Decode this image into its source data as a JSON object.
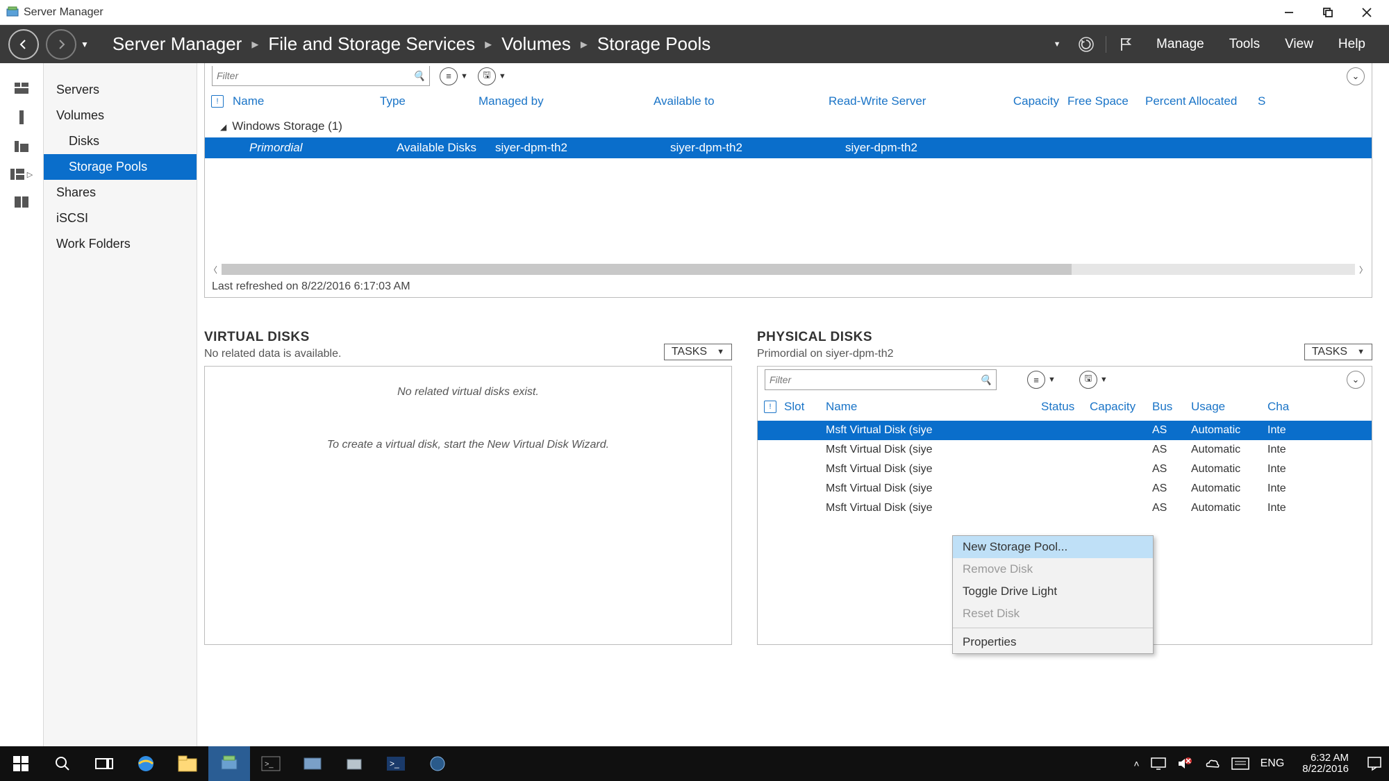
{
  "title": "Server Manager",
  "breadcrumbs": [
    "Server Manager",
    "File and Storage Services",
    "Volumes",
    "Storage Pools"
  ],
  "menus": {
    "manage": "Manage",
    "tools": "Tools",
    "view": "View",
    "help": "Help"
  },
  "sidebar": {
    "items": [
      "Servers",
      "Volumes",
      "Disks",
      "Storage Pools",
      "Shares",
      "iSCSI",
      "Work Folders"
    ]
  },
  "filter": {
    "placeholder": "Filter"
  },
  "storage_pools": {
    "headers": {
      "name": "Name",
      "type": "Type",
      "managed_by": "Managed by",
      "available_to": "Available to",
      "rws": "Read-Write Server",
      "capacity": "Capacity",
      "free_space": "Free Space",
      "percent": "Percent Allocated",
      "s": "S"
    },
    "group": "Windows Storage (1)",
    "row": {
      "name": "Primordial",
      "type": "Available Disks",
      "managed_by": "siyer-dpm-th2",
      "available_to": "siyer-dpm-th2",
      "rws": "siyer-dpm-th2"
    },
    "refreshed": "Last refreshed on 8/22/2016 6:17:03 AM"
  },
  "virtual_disks": {
    "title": "VIRTUAL DISKS",
    "subtitle": "No related data is available.",
    "tasks": "TASKS",
    "msg1": "No related virtual disks exist.",
    "msg2": "To create a virtual disk, start the New Virtual Disk Wizard."
  },
  "physical_disks": {
    "title": "PHYSICAL DISKS",
    "subtitle": "Primordial on siyer-dpm-th2",
    "tasks": "TASKS",
    "filter_placeholder": "Filter",
    "headers": {
      "slot": "Slot",
      "name": "Name",
      "status": "Status",
      "capacity": "Capacity",
      "bus": "Bus",
      "usage": "Usage",
      "chassis": "Cha"
    },
    "rows": [
      {
        "name": "Msft Virtual Disk (siye",
        "bus": "AS",
        "usage": "Automatic",
        "ch": "Inte"
      },
      {
        "name": "Msft Virtual Disk (siye",
        "bus": "AS",
        "usage": "Automatic",
        "ch": "Inte"
      },
      {
        "name": "Msft Virtual Disk (siye",
        "bus": "AS",
        "usage": "Automatic",
        "ch": "Inte"
      },
      {
        "name": "Msft Virtual Disk (siye",
        "bus": "AS",
        "usage": "Automatic",
        "ch": "Inte"
      },
      {
        "name": "Msft Virtual Disk (siye",
        "bus": "AS",
        "usage": "Automatic",
        "ch": "Inte"
      }
    ]
  },
  "context_menu": {
    "items": [
      {
        "label": "New Storage Pool...",
        "highlight": true
      },
      {
        "label": "Remove Disk",
        "disabled": true
      },
      {
        "label": "Toggle Drive Light"
      },
      {
        "label": "Reset Disk",
        "disabled": true
      },
      {
        "sep": true
      },
      {
        "label": "Properties"
      }
    ]
  },
  "tray": {
    "lang": "ENG",
    "time": "6:32 AM",
    "date": "8/22/2016"
  }
}
